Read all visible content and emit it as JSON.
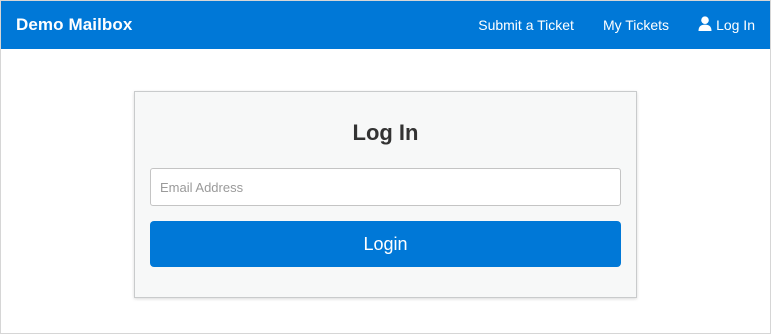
{
  "navbar": {
    "brand": "Demo Mailbox",
    "links": [
      {
        "label": "Submit a Ticket"
      },
      {
        "label": "My Tickets"
      },
      {
        "label": "Log In",
        "icon": "user-icon"
      }
    ],
    "background_color": "#0078d7"
  },
  "login_form": {
    "title": "Log In",
    "email_placeholder": "Email Address",
    "email_value": "",
    "submit_label": "Login",
    "button_color": "#0078d7"
  }
}
